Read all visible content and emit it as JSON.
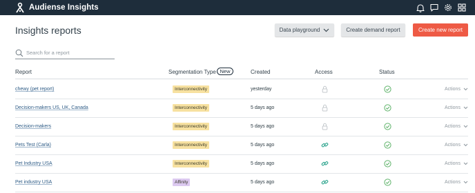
{
  "app": {
    "brand_name": "Audiense Insights",
    "colors": {
      "topbar": "#1e2d3b",
      "accent": "#ee5a45",
      "link": "#2c5a85",
      "status_ok": "#5fb36a",
      "access_shared": "#2aa38c"
    }
  },
  "topbar": {
    "icons": [
      "bell-icon",
      "chat-icon",
      "gear-icon",
      "apps-grid-icon"
    ]
  },
  "page": {
    "title": "Insights reports"
  },
  "toolbar": {
    "playground_label": "Data playground",
    "demand_label": "Create demand report",
    "create_label": "Create new report"
  },
  "search": {
    "placeholder": "Search for a report",
    "value": ""
  },
  "table": {
    "headers": {
      "report": "Report",
      "segmentation": "Segmentation Type",
      "new_badge": "New",
      "created": "Created",
      "access": "Access",
      "status": "Status"
    },
    "rows": [
      {
        "name": "chewy (pet report)",
        "segmentation": "Interconnectivity",
        "created": "yesterday",
        "access": "private",
        "status": "ok",
        "actions": "Actions"
      },
      {
        "name": "Decision-makers US, UK, Canada",
        "segmentation": "Interconnectivity",
        "created": "5 days ago",
        "access": "private",
        "status": "ok",
        "actions": "Actions"
      },
      {
        "name": "Decision-makers",
        "segmentation": "Interconnectivity",
        "created": "5 days ago",
        "access": "private",
        "status": "ok",
        "actions": "Actions"
      },
      {
        "name": "Pets Test (Carla)",
        "segmentation": "Interconnectivity",
        "created": "5 days ago",
        "access": "shared",
        "status": "ok",
        "actions": "Actions"
      },
      {
        "name": "Pet Industry USA",
        "segmentation": "Interconnectivity",
        "created": "5 days ago",
        "access": "shared",
        "status": "ok",
        "actions": "Actions"
      },
      {
        "name": "Pet industry USA",
        "segmentation": "Affinity",
        "created": "5 days ago",
        "access": "shared",
        "status": "ok",
        "actions": "Actions"
      }
    ],
    "segmentation_colors": {
      "Interconnectivity": "#f7e1a0",
      "Affinity": "#dcc9f0"
    }
  }
}
